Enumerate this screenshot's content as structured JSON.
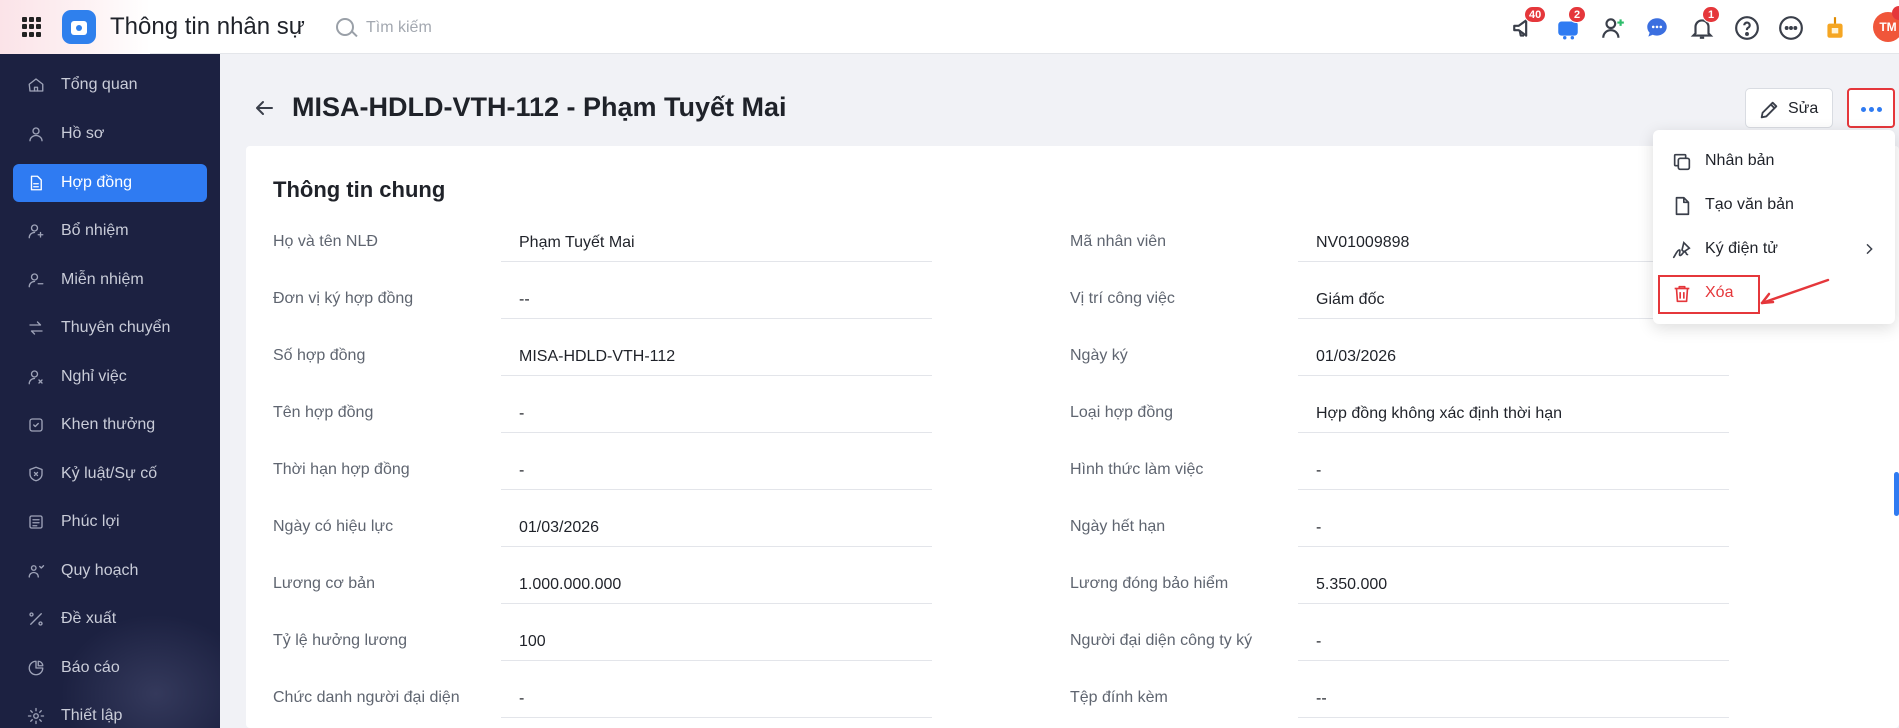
{
  "app": {
    "title": "Thông tin nhân sự"
  },
  "search": {
    "placeholder": "Tìm kiếm"
  },
  "topbar": {
    "badges": {
      "announcements": "40",
      "cart": "2",
      "notifications": "1"
    },
    "avatar_initials": "TM"
  },
  "sidebar": {
    "items": [
      {
        "label": "Tổng quan",
        "icon": "home-icon"
      },
      {
        "label": "Hồ sơ",
        "icon": "user-icon"
      },
      {
        "label": "Hợp đồng",
        "icon": "document-icon",
        "active": true
      },
      {
        "label": "Bổ nhiệm",
        "icon": "user-plus-icon"
      },
      {
        "label": "Miễn nhiệm",
        "icon": "user-minus-icon"
      },
      {
        "label": "Thuyên chuyển",
        "icon": "transfer-icon"
      },
      {
        "label": "Nghỉ việc",
        "icon": "user-leave-icon"
      },
      {
        "label": "Khen thưởng",
        "icon": "award-icon"
      },
      {
        "label": "Kỷ luật/Sự cố",
        "icon": "shield-icon"
      },
      {
        "label": "Phúc lợi",
        "icon": "benefit-icon"
      },
      {
        "label": "Quy hoạch",
        "icon": "planning-icon"
      },
      {
        "label": "Đề xuất",
        "icon": "proposal-icon"
      },
      {
        "label": "Báo cáo",
        "icon": "report-icon"
      },
      {
        "label": "Thiết lập",
        "icon": "settings-icon"
      }
    ]
  },
  "header": {
    "title": "MISA-HDLD-VTH-112 - Phạm Tuyết Mai",
    "edit_label": "Sửa"
  },
  "section": {
    "title": "Thông tin chung"
  },
  "fields_left": [
    {
      "label": "Họ và tên NLĐ",
      "value": "Phạm Tuyết Mai"
    },
    {
      "label": "Đơn vị ký hợp đồng",
      "value": "--"
    },
    {
      "label": "Số hợp đồng",
      "value": "MISA-HDLD-VTH-112"
    },
    {
      "label": "Tên hợp đồng",
      "value": "-"
    },
    {
      "label": "Thời hạn hợp đồng",
      "value": "-"
    },
    {
      "label": "Ngày có hiệu lực",
      "value": "01/03/2026"
    },
    {
      "label": "Lương cơ bản",
      "value": "1.000.000.000"
    },
    {
      "label": "Tỷ lệ hưởng lương",
      "value": "100"
    },
    {
      "label": "Chức danh người đại diện",
      "value": "-"
    }
  ],
  "fields_right": [
    {
      "label": "Mã nhân viên",
      "value": "NV01009898"
    },
    {
      "label": "Vị trí công việc",
      "value": "Giám đốc"
    },
    {
      "label": "Ngày ký",
      "value": "01/03/2026"
    },
    {
      "label": "Loại hợp đồng",
      "value": "Hợp đồng không xác định thời hạn"
    },
    {
      "label": "Hình thức làm việc",
      "value": "-"
    },
    {
      "label": "Ngày hết hạn",
      "value": "-"
    },
    {
      "label": "Lương đóng bảo hiểm",
      "value": "5.350.000"
    },
    {
      "label": "Người đại diện công ty ký",
      "value": "-"
    },
    {
      "label": "Tệp đính kèm",
      "value": "--"
    }
  ],
  "menu": {
    "items": [
      {
        "label": "Nhân bản",
        "icon": "copy-icon"
      },
      {
        "label": "Tạo văn bản",
        "icon": "file-icon"
      },
      {
        "label": "Ký điện tử",
        "icon": "signature-icon",
        "has_submenu": true
      },
      {
        "label": "Xóa",
        "icon": "trash-icon",
        "danger": true
      }
    ]
  },
  "colors": {
    "accent": "#2f7bf2",
    "sidebar_bg": "#1c2141",
    "danger": "#e5373b"
  }
}
